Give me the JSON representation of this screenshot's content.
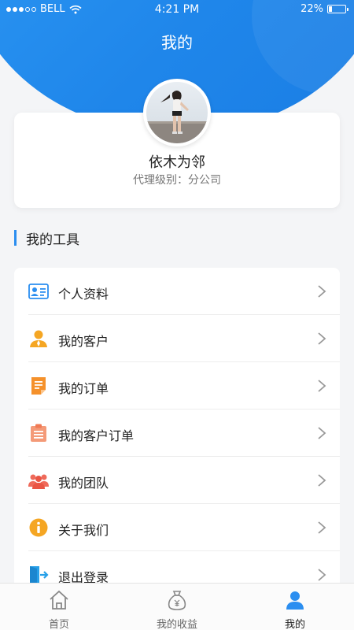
{
  "status_bar": {
    "carrier": "BELL",
    "time": "4:21 PM",
    "battery": "22%",
    "battery_level": 0.22
  },
  "header": {
    "title": "我的"
  },
  "profile": {
    "name": "依木为邻",
    "level": "代理级别：分公司"
  },
  "tools_section": {
    "title": "我的工具"
  },
  "menu": {
    "items": [
      {
        "label": "个人资料",
        "icon": "id-card-icon"
      },
      {
        "label": "我的客户",
        "icon": "customer-icon"
      },
      {
        "label": "我的订单",
        "icon": "order-document-icon"
      },
      {
        "label": "我的客户订单",
        "icon": "clipboard-icon"
      },
      {
        "label": "我的团队",
        "icon": "team-icon"
      },
      {
        "label": "关于我们",
        "icon": "info-icon"
      },
      {
        "label": "退出登录",
        "icon": "logout-icon"
      }
    ]
  },
  "tabbar": {
    "tabs": [
      {
        "label": "首页",
        "icon": "home-icon"
      },
      {
        "label": "我的收益",
        "icon": "money-bag-icon"
      },
      {
        "label": "我的",
        "icon": "user-icon"
      }
    ],
    "active": "我的"
  },
  "colors": {
    "primary": "#2b8ef0",
    "header_gradient_start": "#2f9bf5",
    "header_gradient_end": "#1a7de4",
    "page_bg": "#f4f5f7",
    "customer_icon": "#f5a623",
    "order_icon": "#f5912b",
    "team_icon": "#ef6a5a",
    "info_icon": "#f5a623",
    "logout_icon": "#27a0e8"
  }
}
